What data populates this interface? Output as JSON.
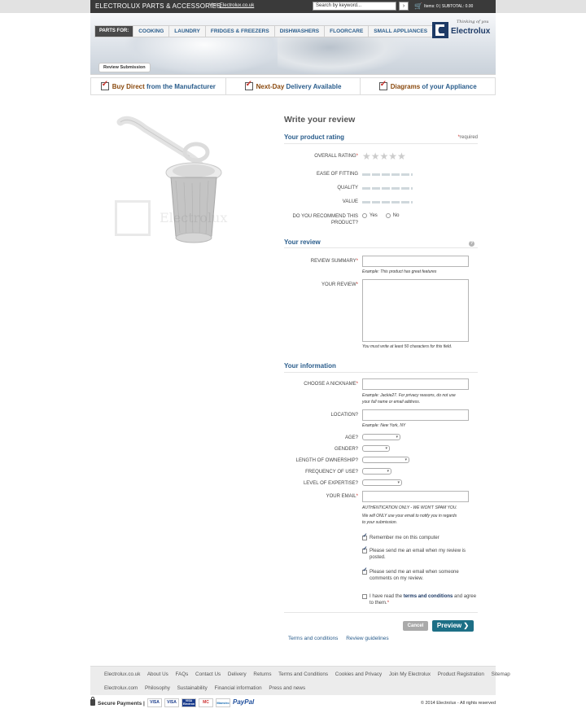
{
  "topbar": {
    "brand_title": "ELECTROLUX PARTS & ACCESSORIES",
    "visit_prefix": "Visit ",
    "visit_link": "Electrolux.co.uk",
    "search_placeholder": "Search by keyword...",
    "search_button": "›",
    "cart_text": "Items: 0  |  SUBTOTAL: 0.00"
  },
  "nav": {
    "parts_for": "PARTS FOR:",
    "items": [
      "COOKING",
      "LAUNDRY",
      "FRIDGES & FREEZERS",
      "DISHWASHERS",
      "FLOORCARE",
      "SMALL APPLIANCES"
    ]
  },
  "logo": {
    "tagline": "Thinking of you",
    "name": "Electrolux"
  },
  "breadcrumb_tab": "Review Submission",
  "benefits": [
    {
      "strong": "Buy Direct",
      "rest": " from the Manufacturer"
    },
    {
      "strong": "Next-Day",
      "rest": " Delivery Available"
    },
    {
      "strong": "Diagrams",
      "rest": " of your Appliance"
    }
  ],
  "watermark_text": "Electrolux",
  "form": {
    "title": "Write your review",
    "product_rating_heading": "Your product rating",
    "required_note": "required",
    "overall_rating_label": "OVERALL RATING",
    "stars": "★★★★★",
    "ease_label": "EASE OF FITTING",
    "quality_label": "QUALITY",
    "value_label": "VALUE",
    "recommend_label_1": "DO YOU RECOMMEND THIS",
    "recommend_label_2": "PRODUCT?",
    "yes": "Yes",
    "no": "No",
    "review_heading": "Your review",
    "help_icon": "?",
    "summary_label": "REVIEW SUMMARY",
    "summary_hint": "Example: This product has great features",
    "review_label": "YOUR REVIEW",
    "review_hint": "You must write at least 50  characters for this field.",
    "info_heading": "Your information",
    "nickname_label": "CHOOSE A NICKNAME",
    "nickname_hint_1": "Example: Jackie27. For privacy reasons, do not use",
    "nickname_hint_2": "your full name or email address.",
    "location_label": "LOCATION?",
    "location_hint": "Example: New York, NY",
    "age_label": "AGE?",
    "gender_label": "GENDER?",
    "ownership_label": "LENGTH OF OWNERSHIP?",
    "frequency_label": "FREQUENCY OF USE?",
    "expertise_label": "LEVEL OF EXPERTISE?",
    "email_label": "YOUR EMAIL",
    "email_hint_1": "AUTHENTICATION ONLY - WE WON'T SPAM YOU.",
    "email_hint_2": "We will ONLY use your email to notify you in regards",
    "email_hint_3": "to your submission.",
    "remember_me": "Remember me on this computer",
    "notify_posted_1": "Please send me an email when my review is",
    "notify_posted_2": "posted.",
    "notify_comment_1": "Please send me an email when someone",
    "notify_comment_2": "comments on my review.",
    "terms_pre": "I have read the ",
    "terms_link": "terms and conditions",
    "terms_post": " and agree",
    "terms_line2": "to them.",
    "cancel": "Cancel",
    "preview": "Preview ❯"
  },
  "bottom_links": [
    "Terms and conditions",
    "Review guidelines"
  ],
  "footer": {
    "row1": [
      "Electrolux.co.uk",
      "About Us",
      "FAQs",
      "Contact Us",
      "Delivery",
      "Returns",
      "Terms and Conditions",
      "Cookies and Privacy",
      "Join My Electrolux",
      "Product Registration",
      "Sitemap"
    ],
    "row2": [
      "Electrolux.com",
      "Philosophy",
      "Sustainability",
      "Financial information",
      "Press and news"
    ],
    "secure_payments": "Secure Payments  |",
    "cards": [
      "VISA",
      "VISA",
      "VISA Electron",
      "MC",
      "Maestro"
    ],
    "paypal": "PayPal",
    "copyright": "© 2014 Electrolux - All rights reserved"
  },
  "colors": {
    "brand_blue": "#1d3a66",
    "link_blue": "#2a5d8c",
    "preview_btn": "#1d6f86",
    "accent_red": "#c8322b"
  }
}
